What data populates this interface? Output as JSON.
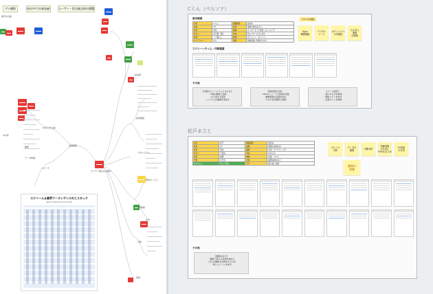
{
  "left_panel": {
    "top_buttons": [
      "アシ補助",
      "分析の中での参加者を",
      "各ユーザー・担当者全体の課題は"
    ],
    "top_label": "保守の分類",
    "branch_labels": [
      "自社調査",
      "センサー組み込み設計",
      "Web上の公開",
      "AI分析",
      "リサーチ",
      "担当者",
      "採用規模",
      "プロジェクト",
      "ひどめ発想",
      "分析",
      "仮説",
      "業務",
      "データ整理",
      "参考サービス",
      "担当"
    ],
    "slide": {
      "title": "スクリーム＆業界ワークレデンスのとスタック",
      "subtitle": "Sales & Marketing Cloud Map"
    }
  },
  "persona_c": {
    "title": "Cくん（ペルソナ）",
    "section_basic": "基本情報",
    "table_rows": [
      [
        "名前",
        "Cくん",
        "職業概要",
        "会社員"
      ],
      [
        "年齢",
        "28",
        "役所",
        "業務の幅を広げる"
      ],
      [
        "性別",
        "男性",
        "職種",
        "ユーザーサイド管理（エンジニア）"
      ],
      [
        "住まい",
        "東京都・都心",
        "年収",
        "新しいサービスに熱心"
      ],
      [
        "家族",
        "一人暮らし",
        "趣味",
        "ガジェット・AIツール"
      ],
      [
        "ITリテラシー",
        "高い",
        "課題",
        "情報収集に時間がかかる"
      ]
    ],
    "sticky_label": "ペルソナの前提",
    "stickies": [
      "Apps\n職業機能",
      "デジタル\nツール",
      "ポテンシャル\nの可能性",
      "カスタム\n業務\nの提案"
    ],
    "section_timeline": "スクリーンタイム・行動履歴",
    "section_other": "その他",
    "gray_boxes": [
      "【内容がフィードバックされる】\n・今後の業務で活用\n・AIに関する知見\n・システムの理解を深める",
      "【情報収集方法】\n・SNSやニュースで情報を収集\n・業務関連の記事を読む\n・ブログを定期的に確認",
      "【ツール選定】\n・使いやすさを重視\n・無料プランを試す\n・比較サイトを参照"
    ]
  },
  "persona_m": {
    "title": "松戸まさと",
    "table_rows": [
      [
        "名前",
        "松戸",
        "職業概要",
        "会社員"
      ],
      [
        "年齢",
        "32",
        "役職",
        "業務の改善担当"
      ],
      [
        "性別",
        "男性",
        "職種",
        "企画・マーケティング"
      ],
      [
        "住まい",
        "千葉県",
        "年収",
        "600万円"
      ],
      [
        "家族",
        "既婚",
        "趣味",
        "読書・カフェ"
      ],
      [
        "学歴",
        "大学卒",
        "目標",
        "業務効率の向上"
      ],
      [
        "好きなこと",
        "新しい発見",
        "苦手",
        "繰り返し作業"
      ]
    ],
    "stickies": [
      "ペルソナ\n分析",
      "データの\n整理",
      "行動分析",
      "情報収集\nのために\nPMSをまとめ",
      "UX改善\nの方向"
    ],
    "sticky_big": "業務の\n改善",
    "section_other": "その他",
    "gray_box": "【業務の中で】\n・業務で使える情報を集める\n・日々の業務を効率化するため\n・新しいツールを試す"
  }
}
